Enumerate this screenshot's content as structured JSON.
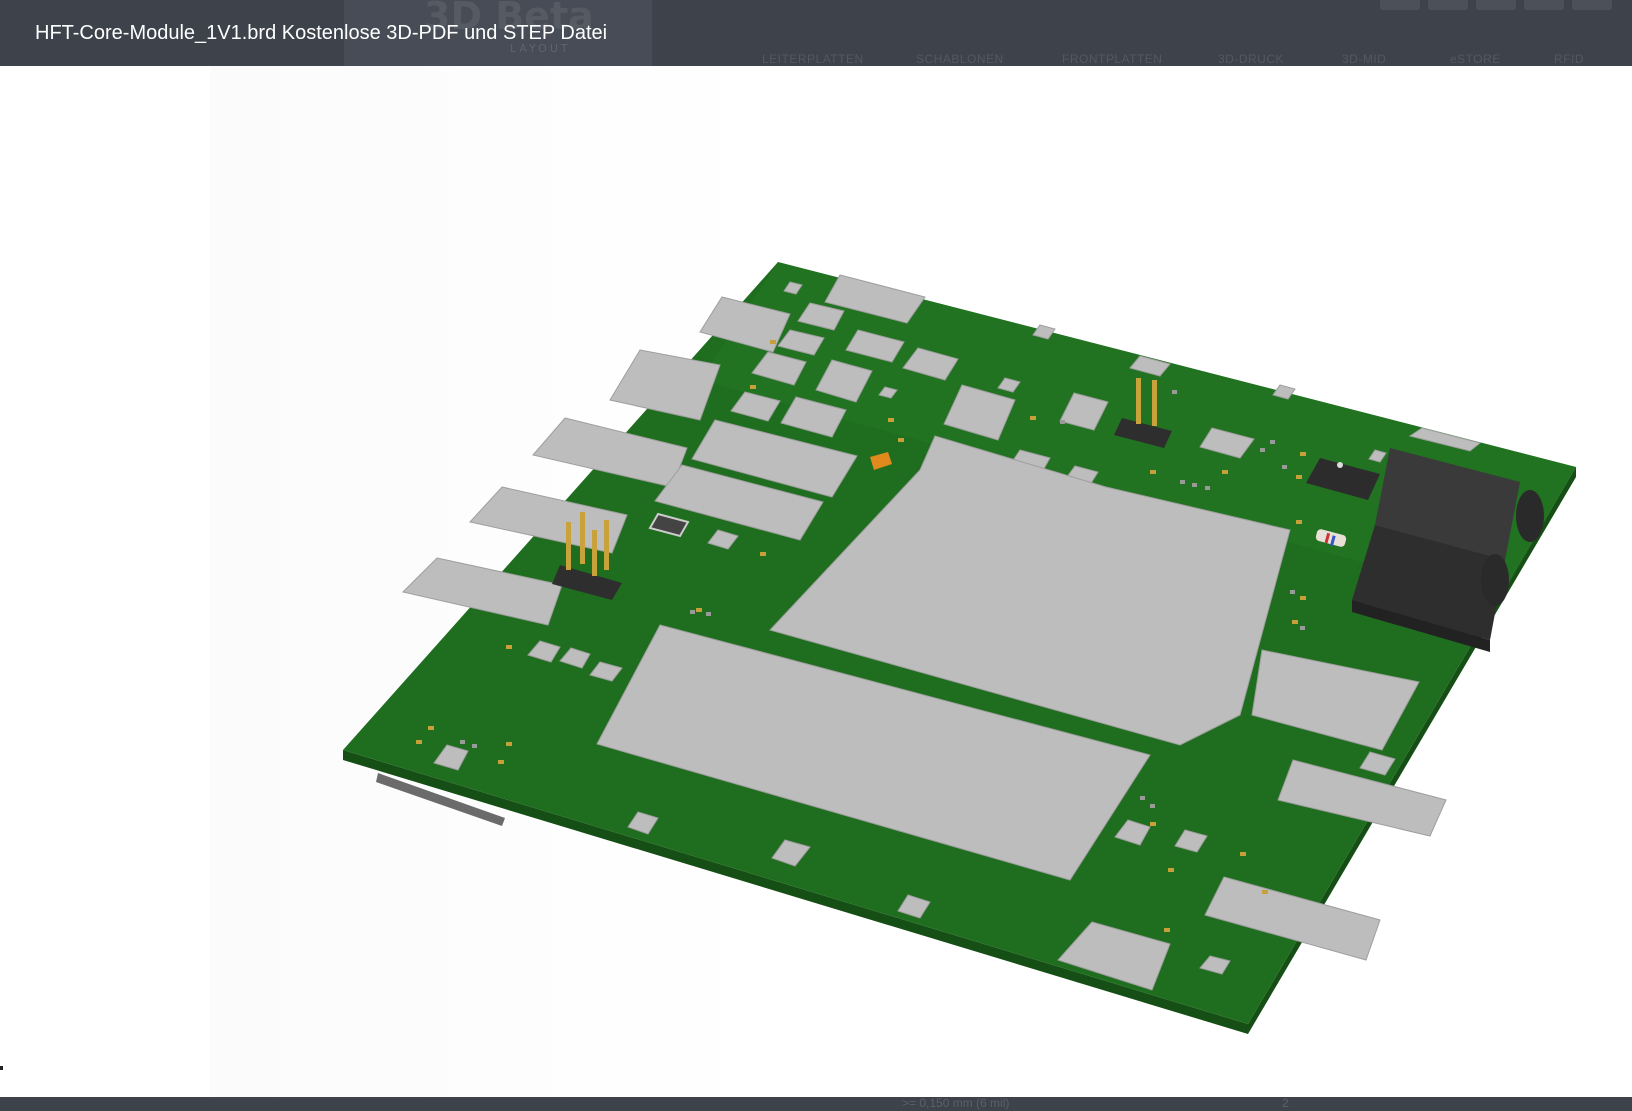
{
  "background_page": {
    "logo": "3D Beta",
    "logo_sub": "LAYOUT",
    "nav": [
      "LEITERPLATTEN",
      "SCHABLONEN",
      "FRONTPLATTEN",
      "3D-DRUCK",
      "3D-MID",
      "eSTORE",
      "RFID"
    ],
    "footer_text": ">= 0,150 mm (6 mil)",
    "footer_value": "2"
  },
  "lightbox": {
    "title": "HFT-Core-Module_1V1.brd Kostenlose 3D-PDF und STEP Datei"
  },
  "colors": {
    "pcb_green": "#1f6e1f",
    "pcb_edge": "#164f16",
    "shield_gray": "#b9b9b9",
    "connector_black": "#2e2e2e",
    "header_bar": "#3d424b"
  }
}
